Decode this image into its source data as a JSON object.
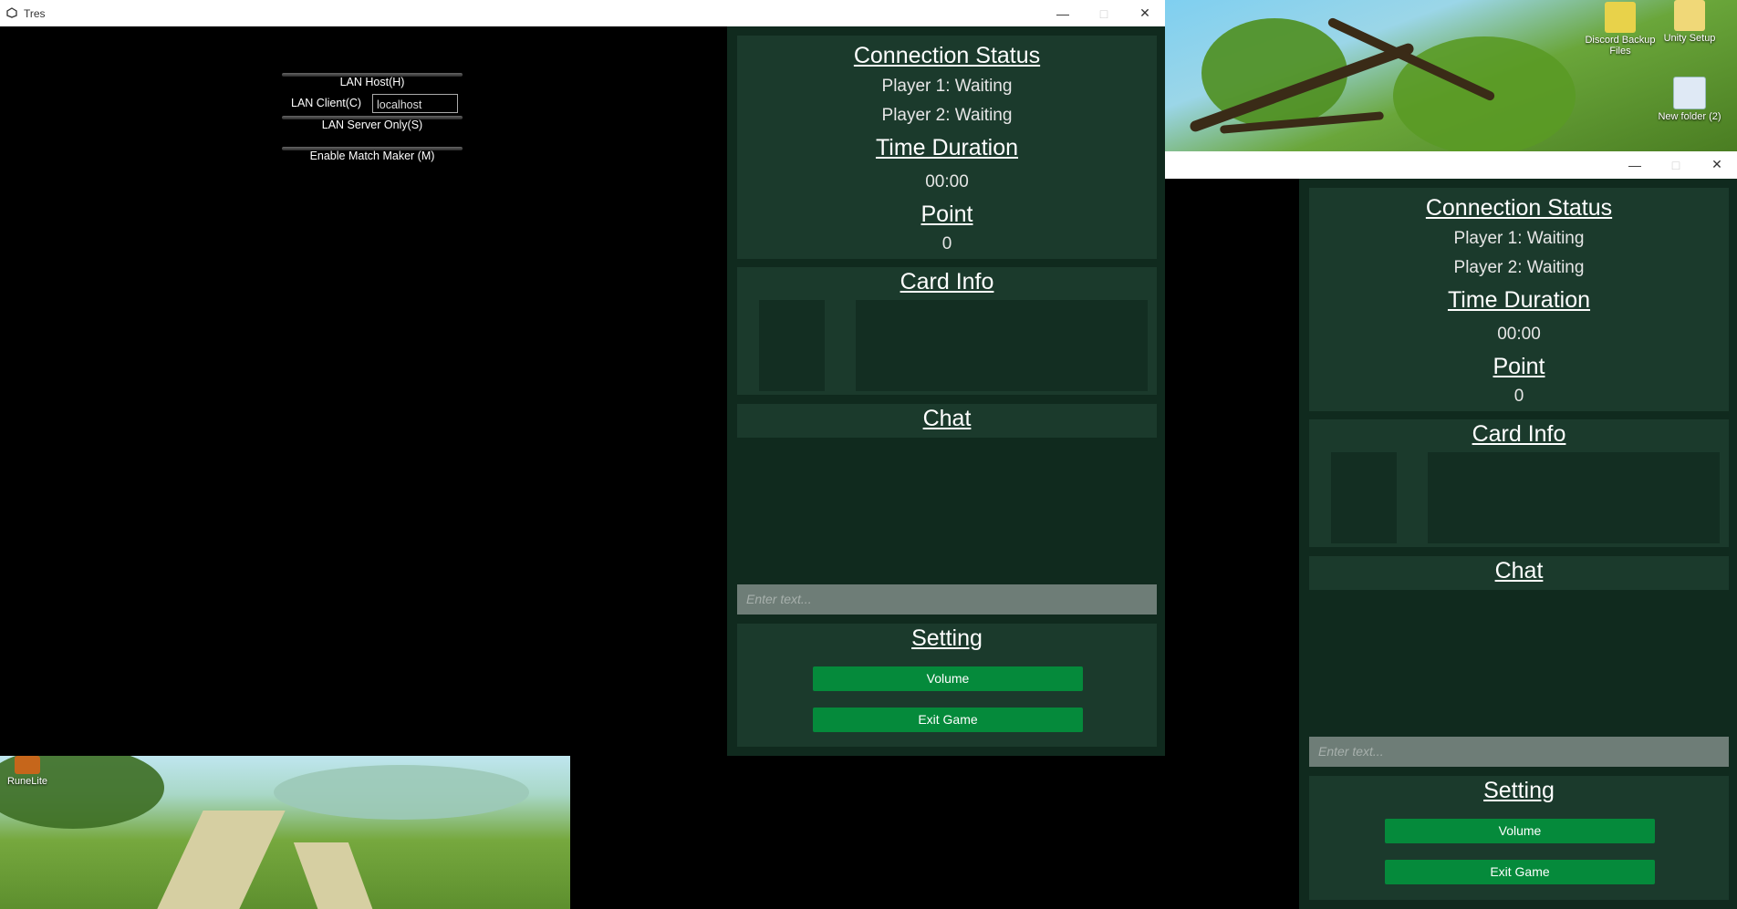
{
  "window_main": {
    "title": "Tres",
    "lan_host": "LAN Host(H)",
    "lan_client": "LAN Client(C)",
    "lan_client_address": "localhost",
    "lan_server_only": "LAN Server Only(S)",
    "match_maker": "Enable Match Maker (M)"
  },
  "window_second": {
    "title": ""
  },
  "panel": {
    "connection_status": "Connection Status",
    "player1": "Player 1: Waiting",
    "player2": "Player 2: Waiting",
    "time_duration": "Time Duration",
    "time_value": "00:00",
    "point": "Point",
    "point_value": "0",
    "card_info": "Card Info",
    "chat": "Chat",
    "chat_placeholder": "Enter text...",
    "setting": "Setting",
    "volume": "Volume",
    "exit": "Exit Game"
  },
  "desktop": {
    "icons": [
      {
        "label": "Discord Backup Files"
      },
      {
        "label": "Unity Setup"
      },
      {
        "label": "New folder (2)"
      },
      {
        "label": "RuneLite"
      }
    ]
  },
  "colors": {
    "panel_bg": "#1b3a2c",
    "inner_box": "#132e22",
    "button_green": "#058a3b",
    "input_bg": "#6e7d77"
  }
}
